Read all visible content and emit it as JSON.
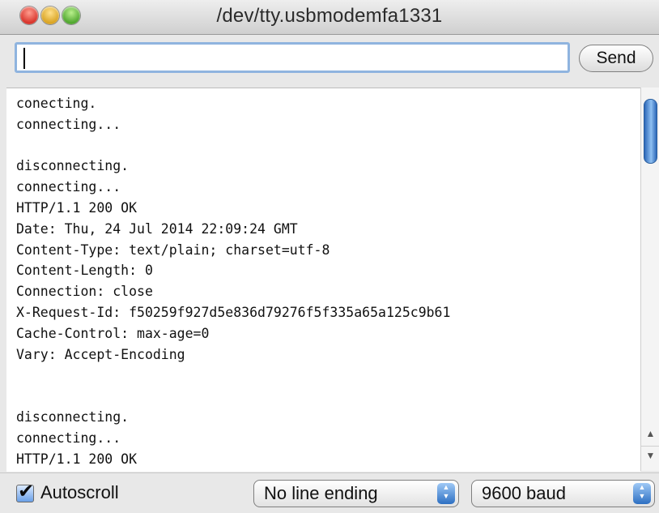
{
  "window": {
    "title": "/dev/tty.usbmodemfa1331"
  },
  "toolbar": {
    "input_value": "",
    "send_label": "Send"
  },
  "console": {
    "lines": [
      "conecting.",
      "connecting...",
      "",
      "disconnecting.",
      "connecting...",
      "HTTP/1.1 200 OK",
      "Date: Thu, 24 Jul 2014 22:09:24 GMT",
      "Content-Type: text/plain; charset=utf-8",
      "Content-Length: 0",
      "Connection: close",
      "X-Request-Id: f50259f927d5e836d79276f5f335a65a125c9b61",
      "Cache-Control: max-age=0",
      "Vary: Accept-Encoding",
      "",
      "",
      "disconnecting.",
      "connecting...",
      "HTTP/1.1 200 OK"
    ]
  },
  "statusbar": {
    "autoscroll_label": "Autoscroll",
    "autoscroll_checked": true,
    "line_ending": "No line ending",
    "baud_rate": "9600 baud"
  },
  "icons": {
    "close": "close-button-icon",
    "minimize": "minimize-button-icon",
    "zoom": "zoom-button-icon",
    "checkmark": "checkmark-icon",
    "stepper": "up-down-stepper-icon"
  },
  "colors": {
    "close": "#d8332a",
    "minimize": "#d9a322",
    "zoom": "#4fa62e",
    "accent": "#2c67b8",
    "input_focus": "#8fb4df"
  }
}
